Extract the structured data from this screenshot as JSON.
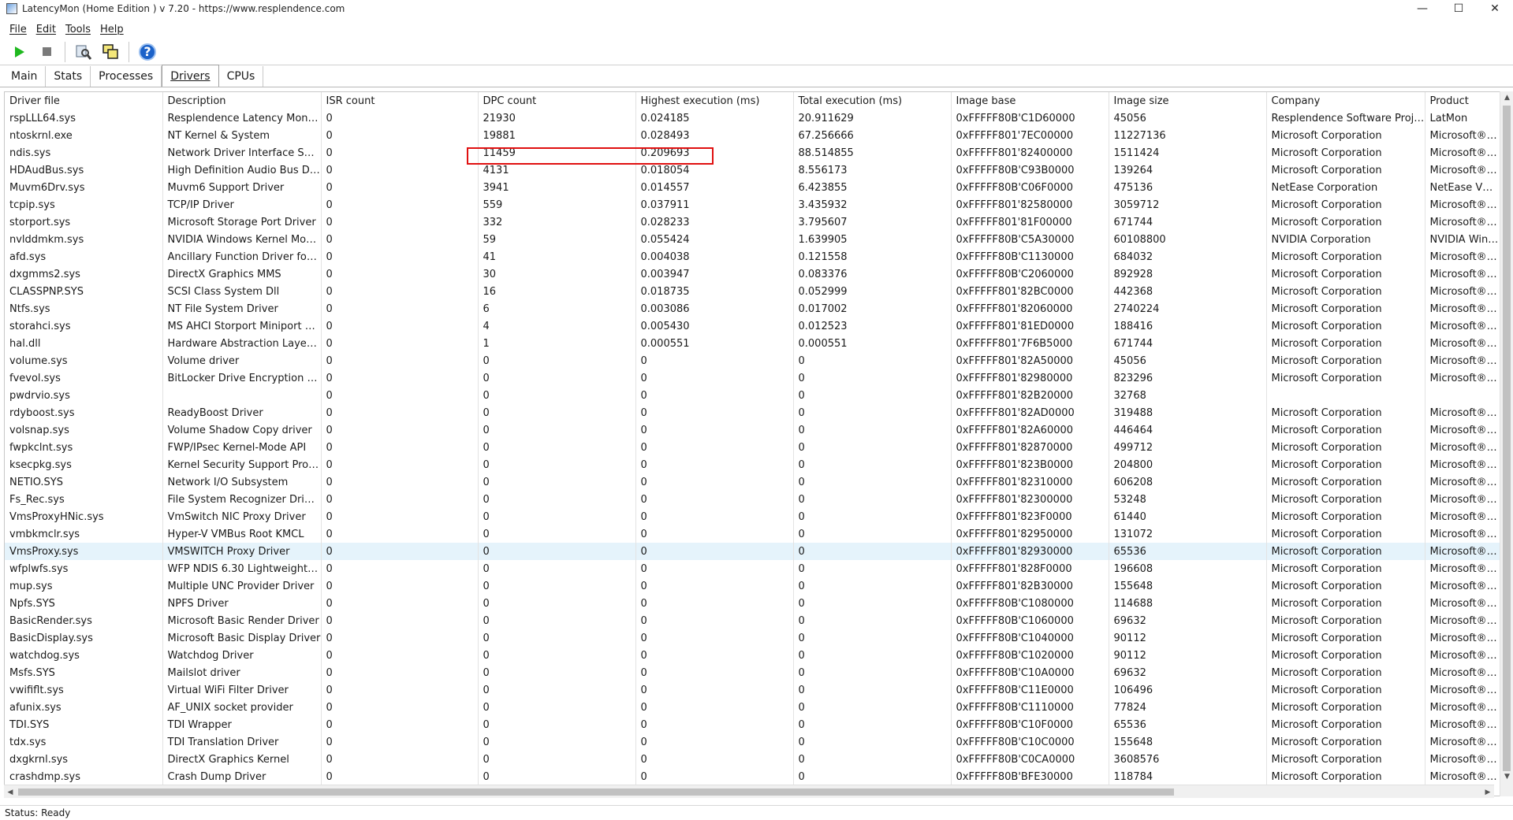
{
  "window": {
    "title": "LatencyMon  (Home Edition )  v 7.20 - https://www.resplendence.com",
    "minimize": "—",
    "maximize": "☐",
    "close": "✕"
  },
  "menu": [
    "File",
    "Edit",
    "Tools",
    "Help"
  ],
  "toolbar": {
    "start_icon": "play-icon",
    "stop_icon": "stop-icon",
    "settings_icon": "tools-icon",
    "windows_icon": "windows-icon",
    "help_label": "?"
  },
  "tabs": [
    "Main",
    "Stats",
    "Processes",
    "Drivers",
    "CPUs"
  ],
  "active_tab": "Drivers",
  "table": {
    "columns": [
      "Driver file",
      "Description",
      "ISR count",
      "DPC count",
      "Highest execution (ms)",
      "Total execution (ms)",
      "Image base",
      "Image size",
      "Company",
      "Product"
    ],
    "rows": [
      [
        "rspLLL64.sys",
        "Resplendence Latency Monit...",
        "0",
        "21930",
        "0.024185",
        "20.911629",
        "0xFFFFF80B'C1D60000",
        "45056",
        "Resplendence Software Proje...",
        "LatMon"
      ],
      [
        "ntoskrnl.exe",
        "NT Kernel & System",
        "0",
        "19881",
        "0.028493",
        "67.256666",
        "0xFFFFF801'7EC00000",
        "11227136",
        "Microsoft Corporation",
        "Microsoft® Wi"
      ],
      [
        "ndis.sys",
        "Network Driver Interface Spe...",
        "0",
        "11459",
        "0.209693",
        "88.514855",
        "0xFFFFF801'82400000",
        "1511424",
        "Microsoft Corporation",
        "Microsoft® Wi"
      ],
      [
        "HDAudBus.sys",
        "High Definition Audio Bus Dri...",
        "0",
        "4131",
        "0.018054",
        "8.556173",
        "0xFFFFF80B'C93B0000",
        "139264",
        "Microsoft Corporation",
        "Microsoft® Wi"
      ],
      [
        "Muvm6Drv.sys",
        "Muvm6 Support Driver",
        "0",
        "3941",
        "0.014557",
        "6.423855",
        "0xFFFFF80B'C06F0000",
        "475136",
        "NetEase Corporation",
        "NetEase VM M"
      ],
      [
        "tcpip.sys",
        "TCP/IP Driver",
        "0",
        "559",
        "0.037911",
        "3.435932",
        "0xFFFFF801'82580000",
        "3059712",
        "Microsoft Corporation",
        "Microsoft® Wi"
      ],
      [
        "storport.sys",
        "Microsoft Storage Port Driver",
        "0",
        "332",
        "0.028233",
        "3.795607",
        "0xFFFFF801'81F00000",
        "671744",
        "Microsoft Corporation",
        "Microsoft® Wi"
      ],
      [
        "nvlddmkm.sys",
        "NVIDIA Windows Kernel Mod...",
        "0",
        "59",
        "0.055424",
        "1.639905",
        "0xFFFFF80B'C5A30000",
        "60108800",
        "NVIDIA Corporation",
        "NVIDIA Windo"
      ],
      [
        "afd.sys",
        "Ancillary Function Driver for ...",
        "0",
        "41",
        "0.004038",
        "0.121558",
        "0xFFFFF80B'C1130000",
        "684032",
        "Microsoft Corporation",
        "Microsoft® Wi"
      ],
      [
        "dxgmms2.sys",
        "DirectX Graphics MMS",
        "0",
        "30",
        "0.003947",
        "0.083376",
        "0xFFFFF80B'C2060000",
        "892928",
        "Microsoft Corporation",
        "Microsoft® Wi"
      ],
      [
        "CLASSPNP.SYS",
        "SCSI Class System Dll",
        "0",
        "16",
        "0.018735",
        "0.052999",
        "0xFFFFF801'82BC0000",
        "442368",
        "Microsoft Corporation",
        "Microsoft® Wi"
      ],
      [
        "Ntfs.sys",
        "NT File System Driver",
        "0",
        "6",
        "0.003086",
        "0.017002",
        "0xFFFFF801'82060000",
        "2740224",
        "Microsoft Corporation",
        "Microsoft® Wi"
      ],
      [
        "storahci.sys",
        "MS AHCI Storport Miniport D...",
        "0",
        "4",
        "0.005430",
        "0.012523",
        "0xFFFFF801'81ED0000",
        "188416",
        "Microsoft Corporation",
        "Microsoft® Wi"
      ],
      [
        "hal.dll",
        "Hardware Abstraction Layer ...",
        "0",
        "1",
        "0.000551",
        "0.000551",
        "0xFFFFF801'7F6B5000",
        "671744",
        "Microsoft Corporation",
        "Microsoft® Wi"
      ],
      [
        "volume.sys",
        "Volume driver",
        "0",
        "0",
        "0",
        "0",
        "0xFFFFF801'82A50000",
        "45056",
        "Microsoft Corporation",
        "Microsoft® Wi"
      ],
      [
        "fvevol.sys",
        "BitLocker Drive Encryption Dr...",
        "0",
        "0",
        "0",
        "0",
        "0xFFFFF801'82980000",
        "823296",
        "Microsoft Corporation",
        "Microsoft® Wi"
      ],
      [
        "pwdrvio.sys",
        "",
        "0",
        "0",
        "0",
        "0",
        "0xFFFFF801'82B20000",
        "32768",
        "",
        ""
      ],
      [
        "rdyboost.sys",
        "ReadyBoost Driver",
        "0",
        "0",
        "0",
        "0",
        "0xFFFFF801'82AD0000",
        "319488",
        "Microsoft Corporation",
        "Microsoft® Wi"
      ],
      [
        "volsnap.sys",
        "Volume Shadow Copy driver",
        "0",
        "0",
        "0",
        "0",
        "0xFFFFF801'82A60000",
        "446464",
        "Microsoft Corporation",
        "Microsoft® Wi"
      ],
      [
        "fwpkclnt.sys",
        "FWP/IPsec Kernel-Mode API",
        "0",
        "0",
        "0",
        "0",
        "0xFFFFF801'82870000",
        "499712",
        "Microsoft Corporation",
        "Microsoft® Wi"
      ],
      [
        "ksecpkg.sys",
        "Kernel Security Support Provi...",
        "0",
        "0",
        "0",
        "0",
        "0xFFFFF801'823B0000",
        "204800",
        "Microsoft Corporation",
        "Microsoft® Wi"
      ],
      [
        "NETIO.SYS",
        "Network I/O Subsystem",
        "0",
        "0",
        "0",
        "0",
        "0xFFFFF801'82310000",
        "606208",
        "Microsoft Corporation",
        "Microsoft® Wi"
      ],
      [
        "Fs_Rec.sys",
        "File System Recognizer Driver",
        "0",
        "0",
        "0",
        "0",
        "0xFFFFF801'82300000",
        "53248",
        "Microsoft Corporation",
        "Microsoft® Wi"
      ],
      [
        "VmsProxyHNic.sys",
        "VmSwitch NIC Proxy Driver",
        "0",
        "0",
        "0",
        "0",
        "0xFFFFF801'823F0000",
        "61440",
        "Microsoft Corporation",
        "Microsoft® Wi"
      ],
      [
        "vmbkmclr.sys",
        "Hyper-V VMBus Root KMCL",
        "0",
        "0",
        "0",
        "0",
        "0xFFFFF801'82950000",
        "131072",
        "Microsoft Corporation",
        "Microsoft® Wi"
      ],
      [
        "VmsProxy.sys",
        "VMSWITCH Proxy Driver",
        "0",
        "0",
        "0",
        "0",
        "0xFFFFF801'82930000",
        "65536",
        "Microsoft Corporation",
        "Microsoft® Wi"
      ],
      [
        "wfplwfs.sys",
        "WFP NDIS 6.30 Lightweight Fil...",
        "0",
        "0",
        "0",
        "0",
        "0xFFFFF801'828F0000",
        "196608",
        "Microsoft Corporation",
        "Microsoft® Wi"
      ],
      [
        "mup.sys",
        "Multiple UNC Provider Driver",
        "0",
        "0",
        "0",
        "0",
        "0xFFFFF801'82B30000",
        "155648",
        "Microsoft Corporation",
        "Microsoft® Wi"
      ],
      [
        "Npfs.SYS",
        "NPFS Driver",
        "0",
        "0",
        "0",
        "0",
        "0xFFFFF80B'C1080000",
        "114688",
        "Microsoft Corporation",
        "Microsoft® Wi"
      ],
      [
        "BasicRender.sys",
        "Microsoft Basic Render Driver",
        "0",
        "0",
        "0",
        "0",
        "0xFFFFF80B'C1060000",
        "69632",
        "Microsoft Corporation",
        "Microsoft® Wi"
      ],
      [
        "BasicDisplay.sys",
        "Microsoft Basic Display Driver",
        "0",
        "0",
        "0",
        "0",
        "0xFFFFF80B'C1040000",
        "90112",
        "Microsoft Corporation",
        "Microsoft® Wi"
      ],
      [
        "watchdog.sys",
        "Watchdog Driver",
        "0",
        "0",
        "0",
        "0",
        "0xFFFFF80B'C1020000",
        "90112",
        "Microsoft Corporation",
        "Microsoft® Wi"
      ],
      [
        "Msfs.SYS",
        "Mailslot driver",
        "0",
        "0",
        "0",
        "0",
        "0xFFFFF80B'C10A0000",
        "69632",
        "Microsoft Corporation",
        "Microsoft® Wi"
      ],
      [
        "vwififlt.sys",
        "Virtual WiFi Filter Driver",
        "0",
        "0",
        "0",
        "0",
        "0xFFFFF80B'C11E0000",
        "106496",
        "Microsoft Corporation",
        "Microsoft® Wi"
      ],
      [
        "afunix.sys",
        "AF_UNIX socket provider",
        "0",
        "0",
        "0",
        "0",
        "0xFFFFF80B'C1110000",
        "77824",
        "Microsoft Corporation",
        "Microsoft® Wi"
      ],
      [
        "TDI.SYS",
        "TDI Wrapper",
        "0",
        "0",
        "0",
        "0",
        "0xFFFFF80B'C10F0000",
        "65536",
        "Microsoft Corporation",
        "Microsoft® Wi"
      ],
      [
        "tdx.sys",
        "TDI Translation Driver",
        "0",
        "0",
        "0",
        "0",
        "0xFFFFF80B'C10C0000",
        "155648",
        "Microsoft Corporation",
        "Microsoft® Wi"
      ],
      [
        "dxgkrnl.sys",
        "DirectX Graphics Kernel",
        "0",
        "0",
        "0",
        "0",
        "0xFFFFF80B'C0CA0000",
        "3608576",
        "Microsoft Corporation",
        "Microsoft® Wi"
      ],
      [
        "crashdmp.sys",
        "Crash Dump Driver",
        "0",
        "0",
        "0",
        "0",
        "0xFFFFF80B'BFE30000",
        "118784",
        "Microsoft Corporation",
        "Microsoft® Wi"
      ]
    ],
    "selected_row": 25,
    "highlighted_row": 2
  },
  "status": "Status: Ready",
  "colors": {
    "selected_row": "#e5f3fb",
    "highlight_box": "#e01010",
    "play": "#1fb81f",
    "help": "#1b62c9"
  }
}
